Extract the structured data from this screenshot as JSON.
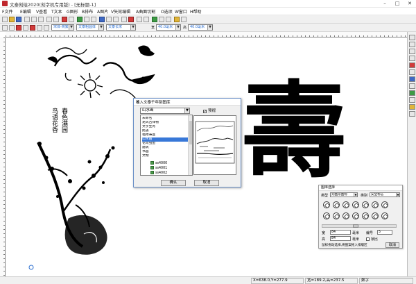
{
  "window": {
    "title": "文泰刻绘2020(刻字机专用版) - [无标题-1]",
    "min": "–",
    "max": "□",
    "close": "✕"
  },
  "menu": [
    "F文件",
    "E编辑",
    "V查看",
    "T文本",
    "G图形",
    "B排布",
    "A图片",
    "V矢效编辑",
    "A曲面切割",
    "O选项",
    "W窗口",
    "H帮助"
  ],
  "toolbar2": {
    "font_cn": "宋体-简繁",
    "font_en": "文泰粗圆体",
    "font_style": "文泰长宋",
    "width_label": "宽",
    "width_value": "40.0毫米",
    "height_label": "高",
    "height_value": "40.0毫米"
  },
  "dialog": {
    "title": "插入文泰千年刻图库",
    "close": "✕",
    "category": "山水画",
    "preview_label": "预视",
    "preview_checked": "✓",
    "categories": [
      "未命名",
      "龙风吉祥物",
      "文字生肖",
      "民族",
      "福禄寿喜",
      "山水画",
      "花鸟虫鱼",
      "建筑",
      "书画",
      "文物"
    ],
    "selected_index": 5,
    "files": [
      "ss4000",
      "ss4001",
      "ss4002"
    ],
    "ok": "确认",
    "cancel": "取消"
  },
  "panel": {
    "title": "图库选择",
    "type_label": "类型",
    "type_value": "刻图形图标",
    "category_label": "类别",
    "category_value": "安全标志",
    "width_label": "宽",
    "width_value": "84",
    "unit1": "毫米",
    "number_label": "编号",
    "number_value": "5",
    "height_label": "高",
    "height_value": "84",
    "unit2": "毫米",
    "lock_label": "锁比",
    "hint": "鼠标拖动选择,将图案拖入排版区",
    "cancel": "取消"
  },
  "status": {
    "coords": "X=638.0,Y=277.9",
    "size": "宽=189.2,高=237.5",
    "mode": "数字"
  },
  "artwork": {
    "shou_char": "壽",
    "poem": "鸟语花香",
    "poem2": "春色满园"
  }
}
